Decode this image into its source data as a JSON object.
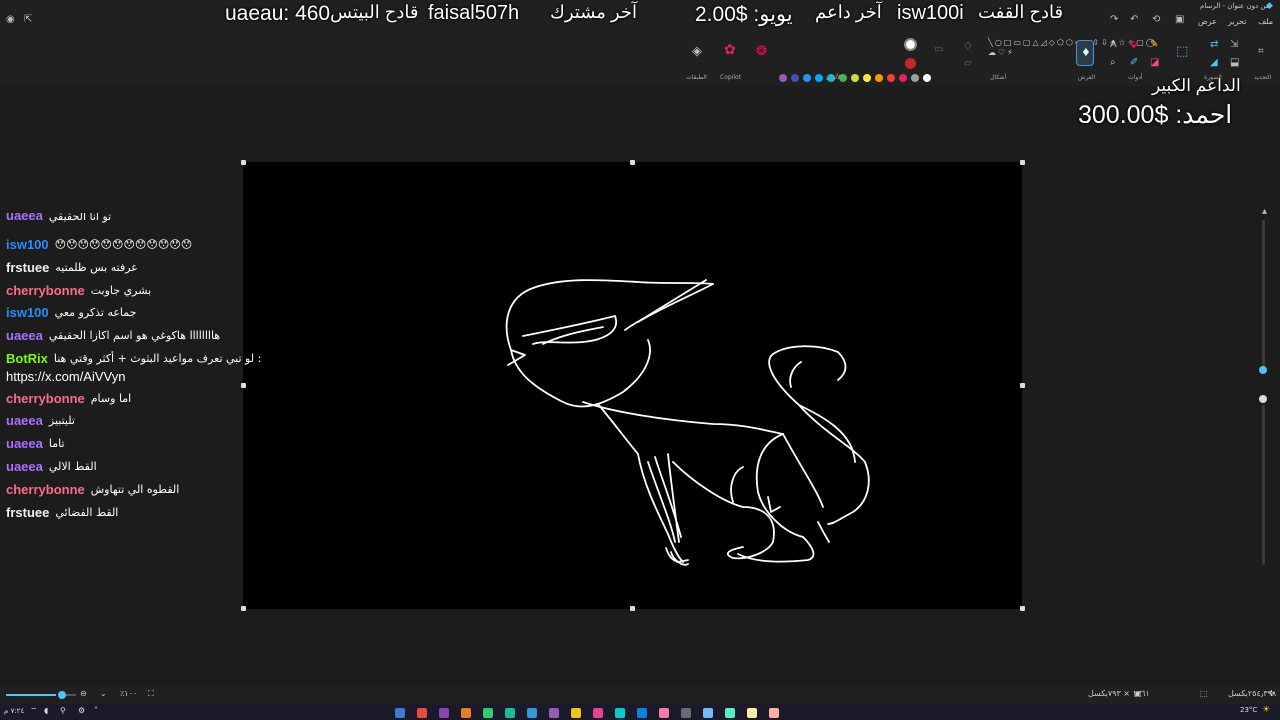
{
  "window": {
    "title": "من دون عنوان - الرسام"
  },
  "menu": {
    "file": "ملف",
    "edit": "تحرير",
    "view": "عرض"
  },
  "ribbon": {
    "groups": {
      "canvas": "الصورة",
      "tools": "أدوات",
      "brushes": "الفرش",
      "shapes": "أشكال",
      "colors": "الألوان",
      "copilot": "Copilot",
      "layers": "الطبقات"
    },
    "palette": [
      "#9b59b6",
      "#3f51b5",
      "#2196f3",
      "#03a9f4",
      "#00bcd4",
      "#4caf50",
      "#cddc39",
      "#ffeb3b",
      "#ff9800",
      "#f44336",
      "#e91e63",
      "#9e9e9e",
      "#ffffff",
      "#7e57c2",
      "#5c6bc0",
      "#42a5f5",
      "#26c6da",
      "#66bb6a",
      "#d4e157",
      "#ffee58",
      "#ffa726",
      "#ef5350",
      "#ec407a",
      "#bdbdbd",
      "#ffffff"
    ],
    "primary_color": "#ffffff",
    "secondary_color": "#c62828"
  },
  "overlay": {
    "last_supporter_label": "آخر داعم",
    "last_supporter_value": "يويو: $2.00",
    "last_subscriber_label": "آخر مشترك",
    "last_subscriber_value": "faisal507h",
    "cheer_label": "قادح القفت",
    "cheer_value": "isw100i",
    "bits_label": "قادح البيتس",
    "bits_value": "uaeau: 460",
    "top_supporter_label": "الداعم الكبير",
    "top_supporter_value": "احمد: $300.00"
  },
  "chat": [
    {
      "user": "uaeea",
      "color": "#a970ff",
      "msg": "تو انا الحقيقي",
      "partial": true
    },
    {
      "user": "isw100",
      "color": "#1e90ff",
      "msg": "😯😯😯😯😯😯😯😯😯😯😯😯"
    },
    {
      "user": "frstuee",
      "color": "#f0f0f0",
      "msg": "عرفته بس ظلمتيه"
    },
    {
      "user": "cherrybonne",
      "color": "#ff6a8a",
      "msg": "بشري جاوبت"
    },
    {
      "user": "isw100",
      "color": "#1e90ff",
      "msg": "جماعه تذكرو معي"
    },
    {
      "user": "uaeea",
      "color": "#a970ff",
      "msg": "هاااااااا هاكوغي هو اسم اكازا الحقيقي"
    },
    {
      "user": "BotRix",
      "color": "#7cfc00",
      "msg": "لو تبي تعرف مواعيد البثوث + أكثر وقتي هنا :",
      "msg2": "https://x.com/AiVVyn"
    },
    {
      "user": "cherrybonne",
      "color": "#ff6a8a",
      "msg": "اما وسام"
    },
    {
      "user": "uaeea",
      "color": "#a970ff",
      "msg": "تليتبيز"
    },
    {
      "user": "uaeea",
      "color": "#a970ff",
      "msg": "تاما"
    },
    {
      "user": "uaeea",
      "color": "#a970ff",
      "msg": "القط الالي"
    },
    {
      "user": "cherrybonne",
      "color": "#ff6a8a",
      "msg": "القطوه الي تتهاوش"
    },
    {
      "user": "frstuee",
      "color": "#f0f0f0",
      "msg": "القط الفضائي"
    }
  ],
  "status": {
    "zoom": "٪١٠٠",
    "canvas_size": "١٣٦١ × ٧٩٣بكسل",
    "cursor": "٢٥٤٫٣٩٨بكسل"
  },
  "taskbar": {
    "weather": "23°C",
    "time": "٧:٢٤ م"
  }
}
